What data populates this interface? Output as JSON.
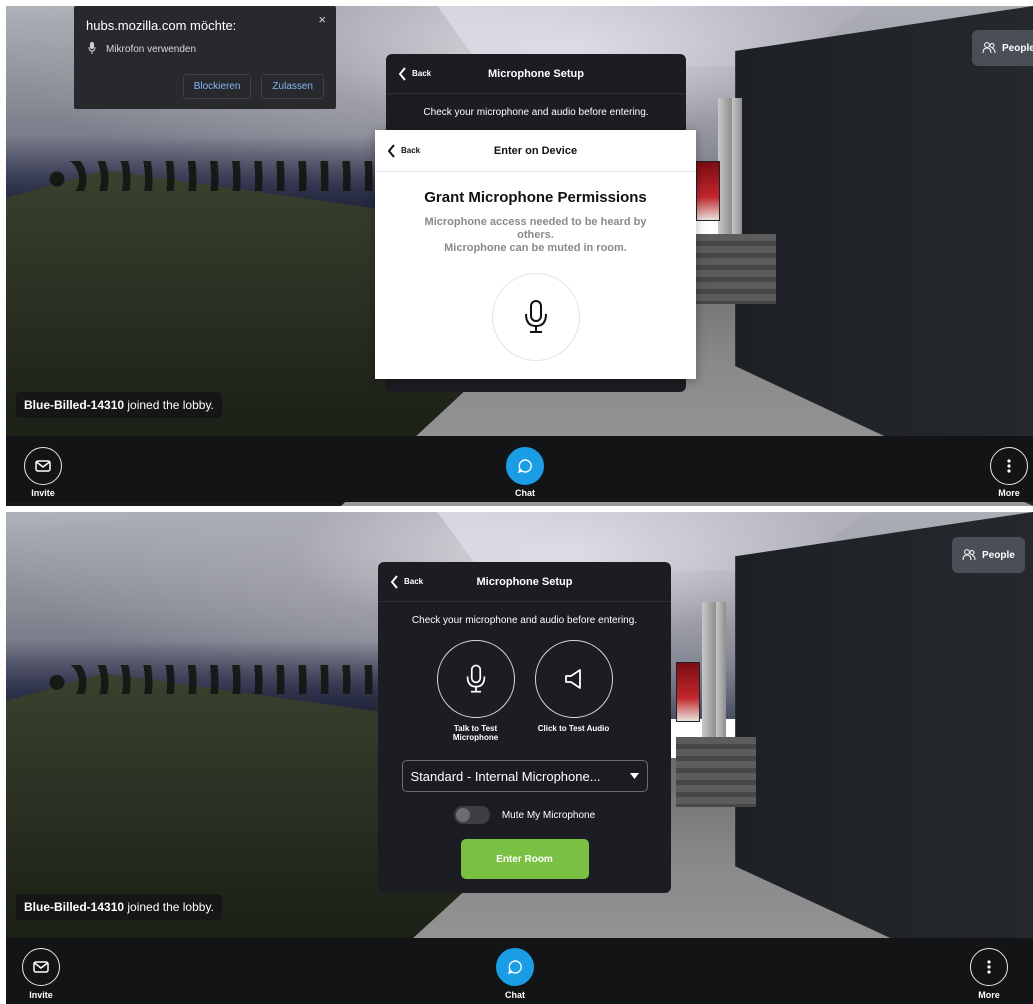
{
  "top": {
    "permission_popup": {
      "title": "hubs.mozilla.com möchte:",
      "item": "Mikrofon verwenden",
      "block_label": "Blockieren",
      "allow_label": "Zulassen",
      "close_glyph": "×"
    },
    "mic_setup": {
      "back_label": "Back",
      "title": "Microphone Setup",
      "description": "Check your microphone and audio before entering."
    },
    "device_modal": {
      "back_label": "Back",
      "title": "Enter on Device",
      "grant_title": "Grant Microphone Permissions",
      "grant_desc_line1": "Microphone access needed to be heard by others.",
      "grant_desc_line2": "Microphone can be muted in room."
    },
    "people_label": "People",
    "toast": {
      "name": "Blue-Billed-14310",
      "message": " joined the lobby."
    },
    "bottom_bar": {
      "invite": "Invite",
      "chat": "Chat",
      "more": "More"
    }
  },
  "bottom": {
    "mic_setup": {
      "back_label": "Back",
      "title": "Microphone Setup",
      "description": "Check your microphone and audio before entering.",
      "talk_label": "Talk to Test Microphone",
      "audio_label": "Click to Test Audio",
      "device_value": "Standard - Internal Microphone...",
      "mute_label": "Mute My Microphone",
      "mute_on": false,
      "enter_label": "Enter Room"
    },
    "people_label": "People",
    "toast": {
      "name": "Blue-Billed-14310",
      "message": " joined the lobby."
    },
    "bottom_bar": {
      "invite": "Invite",
      "chat": "Chat",
      "more": "More"
    }
  },
  "icons": [
    "mic-icon",
    "speaker-icon",
    "envelope-icon",
    "chat-bubble-icon",
    "more-vertical-icon",
    "people-icon",
    "back-chevron-icon",
    "dropdown-arrow-icon"
  ],
  "colors": {
    "chat_blue": "#1b9de6",
    "enter_green": "#7ac143",
    "panel_dark": "#1c1d22",
    "bar_dark": "#121416"
  }
}
